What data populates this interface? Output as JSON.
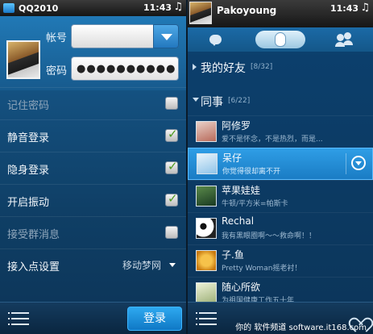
{
  "left": {
    "status": {
      "app_title": "QQ2010",
      "time": "11:43",
      "music_glyph": "♫"
    },
    "login": {
      "account_label": "帐号",
      "account_value": "",
      "password_label": "密码",
      "password_value": "●●●●●●●●●●"
    },
    "settings": [
      {
        "label": "记住密码",
        "checked": false,
        "enabled": false
      },
      {
        "label": "静音登录",
        "checked": true,
        "enabled": true
      },
      {
        "label": "隐身登录",
        "checked": true,
        "enabled": true
      },
      {
        "label": "开启振动",
        "checked": true,
        "enabled": true
      },
      {
        "label": "接受群消息",
        "checked": false,
        "enabled": false
      }
    ],
    "access_point": {
      "label": "接入点设置",
      "value": "移动梦网"
    },
    "login_button": "登录"
  },
  "right": {
    "status": {
      "username": "Pakoyoung",
      "time": "11:43",
      "music_glyph": "♫"
    },
    "groups": [
      {
        "name": "我的好友",
        "count": "[8/32]",
        "expanded": false
      },
      {
        "name": "同事",
        "count": "[6/22]",
        "expanded": true
      }
    ],
    "friends": [
      {
        "name": "阿修罗",
        "status": "爱不是怀念，不是热烈，而是...",
        "avatar_color": "#c97b6a"
      },
      {
        "name": "呆仔",
        "status": "你觉得很却离不开",
        "avatar_color": "#cfe6f7",
        "selected": true
      },
      {
        "name": "苹果娃娃",
        "status": "牛顿/平方米=帕斯卡",
        "avatar_color": "#2d6b3a"
      },
      {
        "name": "Rechal",
        "status": "我有黑眼圈啊～～救命啊！！",
        "avatar_color": "#f2f2f2"
      },
      {
        "name": "子.鱼",
        "status": "Pretty Woman摇老衬！",
        "avatar_color": "#e0a11f"
      },
      {
        "name": "随心所欲",
        "status": "为祖国健康工作五十年",
        "avatar_color": "#c8d8a8"
      }
    ],
    "watermark": "你的 软件频道 software.it168.com"
  }
}
